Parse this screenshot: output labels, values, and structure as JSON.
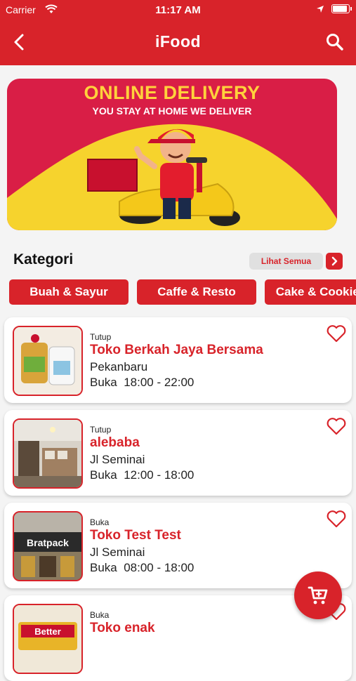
{
  "status_bar": {
    "carrier": "Carrier",
    "time": "11:17 AM"
  },
  "nav": {
    "title": "iFood",
    "back_icon": "chevron-left-icon",
    "search_icon": "search-icon"
  },
  "banner": {
    "headline": "ONLINE DELIVERY",
    "subline": "YOU STAY AT HOME WE DELIVER"
  },
  "categories": {
    "title": "Kategori",
    "see_all_label": "Lihat Semua",
    "items": [
      {
        "label": "Buah & Sayur"
      },
      {
        "label": "Caffe & Resto"
      },
      {
        "label": "Cake & Cookies"
      }
    ]
  },
  "stores": [
    {
      "status": "Tutup",
      "name": "Toko Berkah Jaya Bersama",
      "address": "Pekanbaru",
      "hours": "Buka  18:00 - 22:00"
    },
    {
      "status": "Tutup",
      "name": "alebaba",
      "address": "Jl Seminai",
      "hours": "Buka  12:00 - 18:00"
    },
    {
      "status": "Buka",
      "name": "Toko Test Test",
      "address": "Jl Seminai",
      "hours": "Buka  08:00 - 18:00",
      "thumb_sign": "Bratpack"
    },
    {
      "status": "Buka",
      "name": "Toko enak",
      "address": "",
      "hours": "",
      "thumb_sign": "Better"
    }
  ],
  "colors": {
    "primary": "#d8232a",
    "banner_bg": "#d91e46",
    "banner_yellow": "#f6d32d"
  },
  "fab": {
    "icon": "cart-icon"
  }
}
